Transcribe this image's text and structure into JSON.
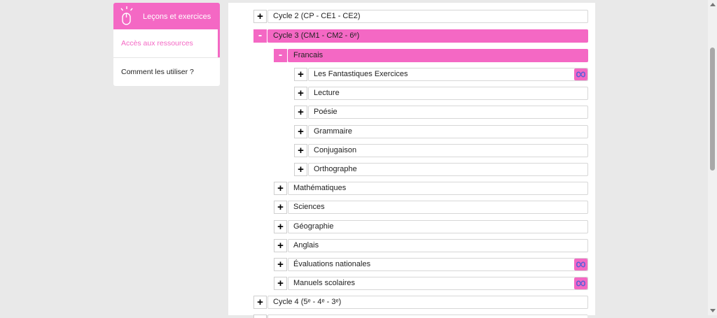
{
  "sidebar": {
    "header": {
      "label": "Leçons et exercices",
      "icon": "mouse-click-icon"
    },
    "items": [
      {
        "label": "Accès aux ressources",
        "active": true
      },
      {
        "label": "Comment les utiliser ?",
        "active": false
      }
    ]
  },
  "tree": {
    "cycle2": {
      "label": "Cycle 2 (CP - CE1 - CE2)",
      "toggle": "+"
    },
    "cycle3": {
      "label": "Cycle 3 (CM1 - CM2 - 6ᵉ)",
      "toggle": "-"
    },
    "francais": {
      "label": "Francais",
      "toggle": "-"
    },
    "francais_children": [
      {
        "label": "Les Fantastiques Exercices",
        "toggle": "+"
      },
      {
        "label": "Lecture",
        "toggle": "+"
      },
      {
        "label": "Poésie",
        "toggle": "+"
      },
      {
        "label": "Grammaire",
        "toggle": "+"
      },
      {
        "label": "Conjugaison",
        "toggle": "+"
      },
      {
        "label": "Orthographe",
        "toggle": "+"
      }
    ],
    "subjects": [
      {
        "label": "Mathématiques",
        "toggle": "+"
      },
      {
        "label": "Sciences",
        "toggle": "+"
      },
      {
        "label": "Géographie",
        "toggle": "+"
      },
      {
        "label": "Anglais",
        "toggle": "+"
      },
      {
        "label": "Évaluations nationales",
        "toggle": "+"
      },
      {
        "label": "Manuels scolaires",
        "toggle": "+"
      }
    ],
    "cycle4": {
      "label": "Cycle 4 (5ᵉ - 4ᵉ - 3ᵉ)",
      "toggle": "+"
    }
  },
  "colors": {
    "accent": "#f468c4",
    "link_icon": "#5a5fd8"
  },
  "icons": {
    "link": "infinity-link-icon"
  }
}
